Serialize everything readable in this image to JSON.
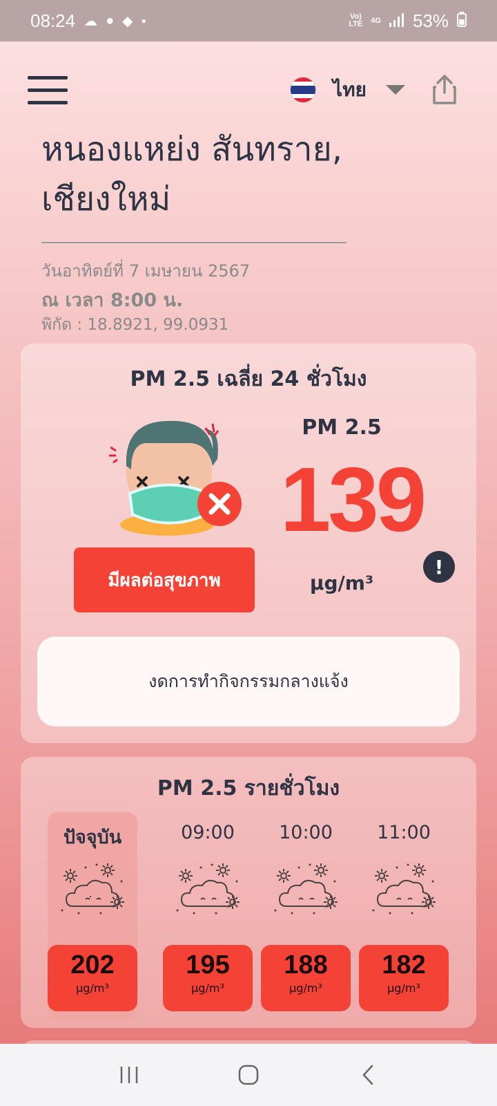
{
  "status_bar": {
    "time": "08:24",
    "battery": "53%",
    "network": "4G",
    "volte": "Vo))\nLTE"
  },
  "header": {
    "language": "ไทย",
    "flag": "thailand-flag"
  },
  "location": {
    "name": "หนองแหย่ง สันทราย, เชียงใหม่",
    "date": "วันอาทิตย์ที่ 7 เมษายน 2567",
    "time": "ณ เวลา 8:00 น.",
    "coordinates": "พิกัด : 18.8921, 99.0931"
  },
  "pm_daily": {
    "title": "PM 2.5 เฉลี่ย 24 ชั่วโมง",
    "label": "PM 2.5",
    "value": "139",
    "unit": "μg/m³",
    "status": "มีผลต่อสุขภาพ",
    "advice": "งดการทำกิจกรรมกลางแจ้ง",
    "color": "#f44336"
  },
  "pm_hourly": {
    "title": "PM 2.5 รายชั่วโมง",
    "items": [
      {
        "label": "ปัจจุบัน",
        "value": "202",
        "unit": "μg/m³"
      },
      {
        "label": "09:00",
        "value": "195",
        "unit": "μg/m³"
      },
      {
        "label": "10:00",
        "value": "188",
        "unit": "μg/m³"
      },
      {
        "label": "11:00",
        "value": "182",
        "unit": "μg/m³"
      }
    ]
  }
}
